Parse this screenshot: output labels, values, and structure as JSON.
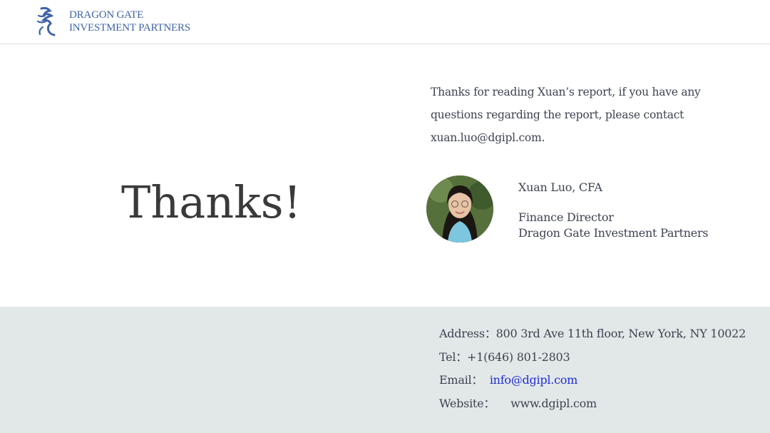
{
  "brand": {
    "line1": "DRAGON GATE",
    "line2": "INVESTMENT PARTNERS",
    "colors": {
      "brand_blue": "#3f63a8",
      "footer_bg": "#e2e8e8",
      "link_blue": "#1f2bd6"
    }
  },
  "slide": {
    "thanks": "Thanks!",
    "intro": "Thanks for reading Xuan’s report, if you have any questions regarding the report, please contact xuan.luo@dgipl.com."
  },
  "person": {
    "name": "Xuan Luo, CFA",
    "role": "Finance Director",
    "company": "Dragon Gate Investment Partners"
  },
  "contact": {
    "address_label": "Address：",
    "address": "800 3rd Ave 11th floor, New York, NY 10022",
    "tel_label": "Tel：",
    "tel": "+1(646) 801-2803",
    "email_label": "Email：",
    "email": "info@dgipl.com",
    "website_label": "Website：",
    "website": "www.dgipl.com"
  }
}
